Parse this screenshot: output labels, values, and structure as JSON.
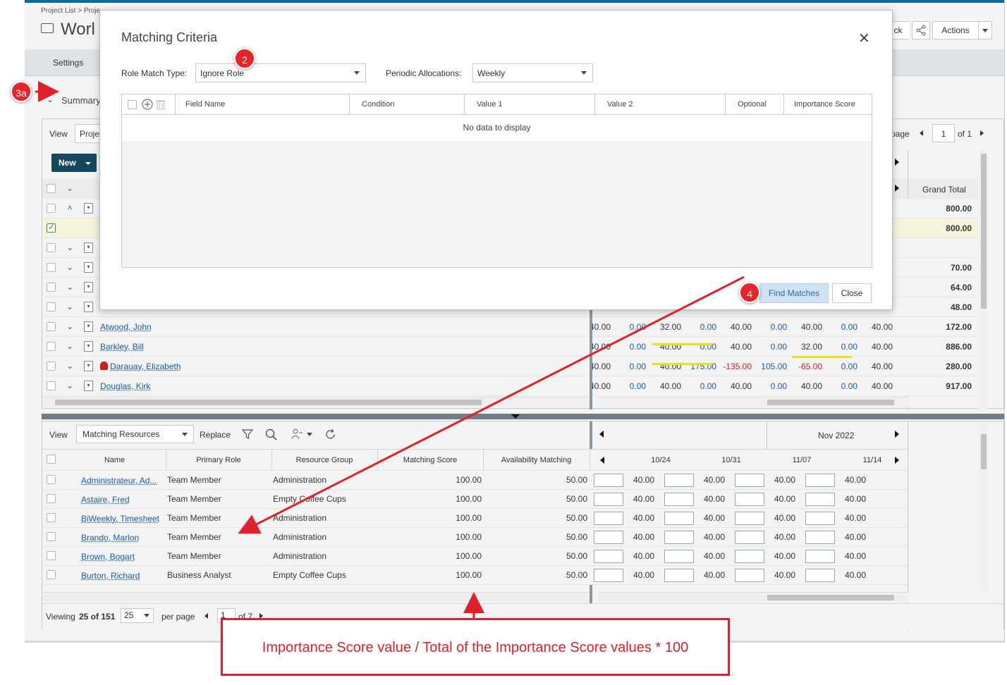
{
  "app": {
    "breadcrumb": "Project List > Proje",
    "title": "Worl",
    "settings_tab": "Settings",
    "actions_label": "Actions",
    "summary_label": "Summary",
    "view_label": "View",
    "view_value": "Proje",
    "new_button": "New",
    "page_label": "page",
    "page_value": "1",
    "page_of": "of 1",
    "grand_total_header": "Grand Total",
    "back_partial": "ck"
  },
  "upper_rows": [
    {
      "name": "",
      "cells": [],
      "total": "800.00"
    },
    {
      "name": "",
      "cells": [],
      "total": "800.00",
      "checked": true
    },
    {
      "name": "",
      "cells": [],
      "total": ""
    },
    {
      "name": "",
      "cells": [],
      "total": "70.00"
    },
    {
      "name": "",
      "cells": [],
      "total": "64.00"
    },
    {
      "name": "",
      "cells": [],
      "total": "48.00"
    },
    {
      "name": "Atwood, John",
      "cells": [
        "40.00",
        "0.00",
        "32.00",
        "0.00",
        "40.00",
        "0.00",
        "40.00",
        "0.00",
        "40.00"
      ],
      "total": "172.00"
    },
    {
      "name": "Barkley, Bill",
      "cells": [
        "40.00",
        "0.00",
        "40.00",
        "0.00",
        "40.00",
        "0.00",
        "32.00",
        "0.00",
        "40.00"
      ],
      "total": "886.00"
    },
    {
      "name": "Darauay, Elizabeth",
      "cells": [
        "40.00",
        "0.00",
        "40.00",
        "175.00",
        "-135.00",
        "105.00",
        "-65.00",
        "0.00",
        "40.00"
      ],
      "total": "280.00"
    },
    {
      "name": "Douglas, Kirk",
      "cells": [
        "40.00",
        "0.00",
        "40.00",
        "0.00",
        "40.00",
        "0.00",
        "40.00",
        "0.00",
        "40.00"
      ],
      "total": "917.00"
    }
  ],
  "lower": {
    "view_label": "View",
    "view_value": "Matching Resources",
    "replace_label": "Replace",
    "columns": [
      "Name",
      "Primary Role",
      "Resource Group",
      "Matching Score",
      "Availability Matching"
    ],
    "month": "Nov 2022",
    "weeks": [
      "10/24",
      "10/31",
      "11/07",
      "11/14"
    ],
    "rows": [
      {
        "name": "Administrateur, Ad...",
        "role": "Team Member",
        "group": "Administration",
        "score": "100.00",
        "avail": "50.00",
        "week": "40.00"
      },
      {
        "name": "Astaire, Fred",
        "role": "Team Member",
        "group": "Empty Coffee Cups",
        "score": "100.00",
        "avail": "50.00",
        "week": "40.00"
      },
      {
        "name": "BiWeekly, Timesheet",
        "role": "Team Member",
        "group": "Administration",
        "score": "100.00",
        "avail": "50.00",
        "week": "40.00"
      },
      {
        "name": "Brando, Marlon",
        "role": "Team Member",
        "group": "Administration",
        "score": "100.00",
        "avail": "50.00",
        "week": "40.00"
      },
      {
        "name": "Brown, Bogart",
        "role": "Team Member",
        "group": "Administration",
        "score": "100.00",
        "avail": "50.00",
        "week": "40.00"
      },
      {
        "name": "Burton, Richard",
        "role": "Business Analyst",
        "group": "Empty Coffee Cups",
        "score": "100.00",
        "avail": "50.00",
        "week": "40.00"
      }
    ],
    "footer_viewing": "Viewing",
    "footer_count": "25 of 151",
    "per_page_value": "25",
    "per_page_label": "per page",
    "page_value": "1",
    "page_of": "of 7"
  },
  "modal": {
    "title": "Matching Criteria",
    "role_match_label": "Role Match Type:",
    "role_match_value": "Ignore Role",
    "periodic_label": "Periodic Allocations:",
    "periodic_value": "Weekly",
    "columns": [
      "Field Name",
      "Condition",
      "Value 1",
      "Value 2",
      "Optional",
      "Importance Score"
    ],
    "no_data": "No data to display",
    "find_matches": "Find Matches",
    "close": "Close"
  },
  "annotations": {
    "badge_3a": "3a",
    "badge_2": "2",
    "badge_4": "4",
    "note": "Importance Score value / Total of the Importance Score values * 100",
    "accent_color": "#e8232a"
  }
}
